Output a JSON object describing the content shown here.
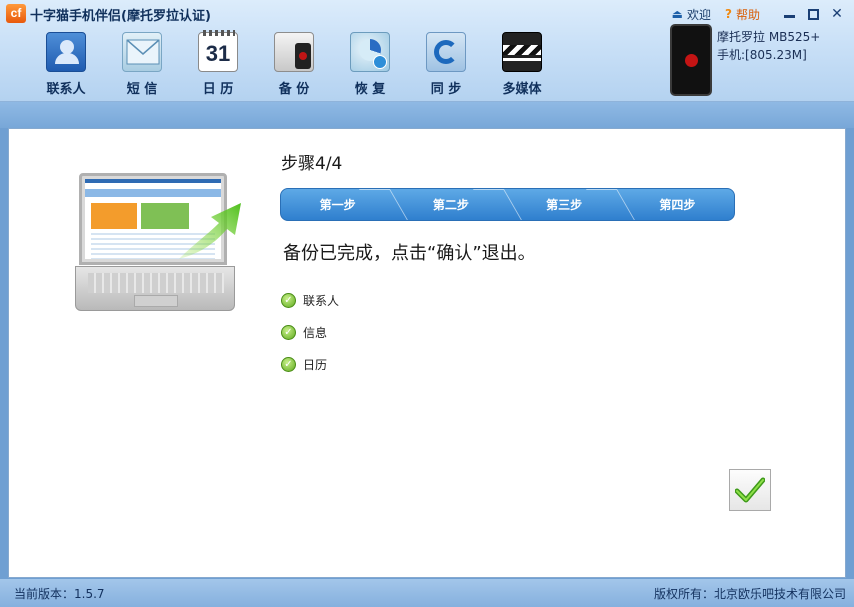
{
  "window": {
    "title": "十字猫手机伴侣(摩托罗拉认证)",
    "logo_text": "cf",
    "welcome_label": "欢迎",
    "help_label": "帮助"
  },
  "toolbar": {
    "items": [
      {
        "label": "联系人",
        "icon": "contacts-icon"
      },
      {
        "label": "短 信",
        "icon": "sms-icon"
      },
      {
        "label": "日 历",
        "icon": "calendar-icon",
        "icon_text": "31"
      },
      {
        "label": "备 份",
        "icon": "backup-icon"
      },
      {
        "label": "恢 复",
        "icon": "restore-icon"
      },
      {
        "label": "同 步",
        "icon": "sync-icon"
      },
      {
        "label": "多媒体",
        "icon": "multimedia-icon"
      }
    ]
  },
  "phone": {
    "name": "摩托罗拉 MB525+",
    "storage": "手机:[805.23M]"
  },
  "wizard": {
    "step_title": "步骤4/4",
    "steps": [
      "第一步",
      "第二步",
      "第三步",
      "第四步"
    ],
    "message": "备份已完成，点击“确认”退出。",
    "completed_items": [
      "联系人",
      "信息",
      "日历"
    ]
  },
  "statusbar": {
    "version": "当前版本：1.5.7",
    "copyright": "版权所有：北京欧乐吧技术有限公司"
  },
  "colors": {
    "accent": "#2f7fce",
    "check_green": "#5faa1e",
    "header_bg": "#c9e0f7"
  }
}
